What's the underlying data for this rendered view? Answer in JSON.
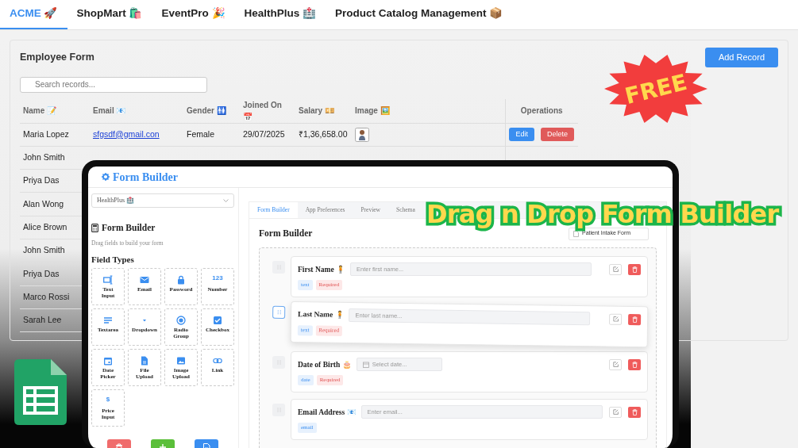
{
  "top_tabs": [
    {
      "label": "ACME 🚀",
      "selected": true
    },
    {
      "label": "ShopMart 🛍️",
      "selected": false
    },
    {
      "label": "EventPro 🎉",
      "selected": false
    },
    {
      "label": "HealthPlus 🏥",
      "selected": false
    },
    {
      "label": "Product Catalog Management 📦",
      "selected": false
    }
  ],
  "employee_form": {
    "title": "Employee Form",
    "add_button": "Add Record",
    "search": {
      "placeholder": "Search records..."
    },
    "table": {
      "columns": [
        "Name 📝",
        "Email 📧",
        "Gender 🚻",
        "Joined On 📅",
        "Salary 💴",
        "Image 🖼️",
        "Operations"
      ],
      "rows": [
        {
          "cells": [
            "Maria Lopez",
            "sfgsdf@gmail.con",
            "Female",
            "29/07/2025",
            "₹1,36,658.00"
          ],
          "avatar": true,
          "actions": [
            "Edit",
            "Delete"
          ]
        },
        {
          "cells": [
            "John Smith"
          ]
        },
        {
          "cells": [
            "Priya Das"
          ]
        },
        {
          "cells": [
            "Alan Wong"
          ]
        },
        {
          "cells": [
            "Alice Brown"
          ]
        },
        {
          "cells": [
            "John Smith"
          ]
        },
        {
          "cells": [
            "Priya Das"
          ]
        },
        {
          "cells": [
            "Marco Rossi"
          ]
        },
        {
          "cells": [
            "Sarah Lee"
          ]
        }
      ]
    }
  },
  "badge": "FREE",
  "headline": "Drag n Drop Form Builder",
  "form_builder": {
    "title": "Form Builder",
    "app_select": "HealthPlus 🏥",
    "palette": {
      "title": "Form Builder",
      "subtitle": "Drag fields to build your form",
      "section": "Field Types",
      "fields": [
        {
          "kind": "text",
          "label": "Text Input"
        },
        {
          "kind": "email",
          "label": "Email"
        },
        {
          "kind": "password",
          "label": "Password"
        },
        {
          "kind": "number",
          "label": "Number",
          "glyph": "123"
        },
        {
          "kind": "textarea",
          "label": "Textarea"
        },
        {
          "kind": "dropdown",
          "label": "Dropdown"
        },
        {
          "kind": "radio",
          "label": "Radio Group"
        },
        {
          "kind": "checkbox",
          "label": "Checkbox"
        },
        {
          "kind": "date",
          "label": "Date Picker"
        },
        {
          "kind": "file",
          "label": "File Upload"
        },
        {
          "kind": "image",
          "label": "Image Upload"
        },
        {
          "kind": "link",
          "label": "Link"
        },
        {
          "kind": "price",
          "label": "Price Input",
          "glyph": "$"
        }
      ]
    },
    "tabs": [
      {
        "label": "Form Builder",
        "selected": true
      },
      {
        "label": "App Preferences",
        "selected": false
      },
      {
        "label": "Preview",
        "selected": false
      },
      {
        "label": "Schema",
        "selected": false
      }
    ],
    "canvas": {
      "title": "Form Builder",
      "form_name": "Patient Intake Form",
      "fields": [
        {
          "kind": "text",
          "label": "First Name 🧍",
          "placeholder": "Enter first name...",
          "type_tag": "text",
          "required_tag": "Required",
          "dragging": false
        },
        {
          "kind": "text",
          "label": "Last Name 🧍",
          "placeholder": "Enter last name...",
          "type_tag": "text",
          "required_tag": "Required",
          "dragging": true
        },
        {
          "kind": "date",
          "label": "Date of Birth 🎂",
          "placeholder": "Select date...",
          "type_tag": "date",
          "required_tag": "Required",
          "dragging": false
        },
        {
          "kind": "text",
          "label": "Email Address 📧",
          "placeholder": "Enter email...",
          "type_tag": "email",
          "dragging": false
        }
      ]
    }
  }
}
